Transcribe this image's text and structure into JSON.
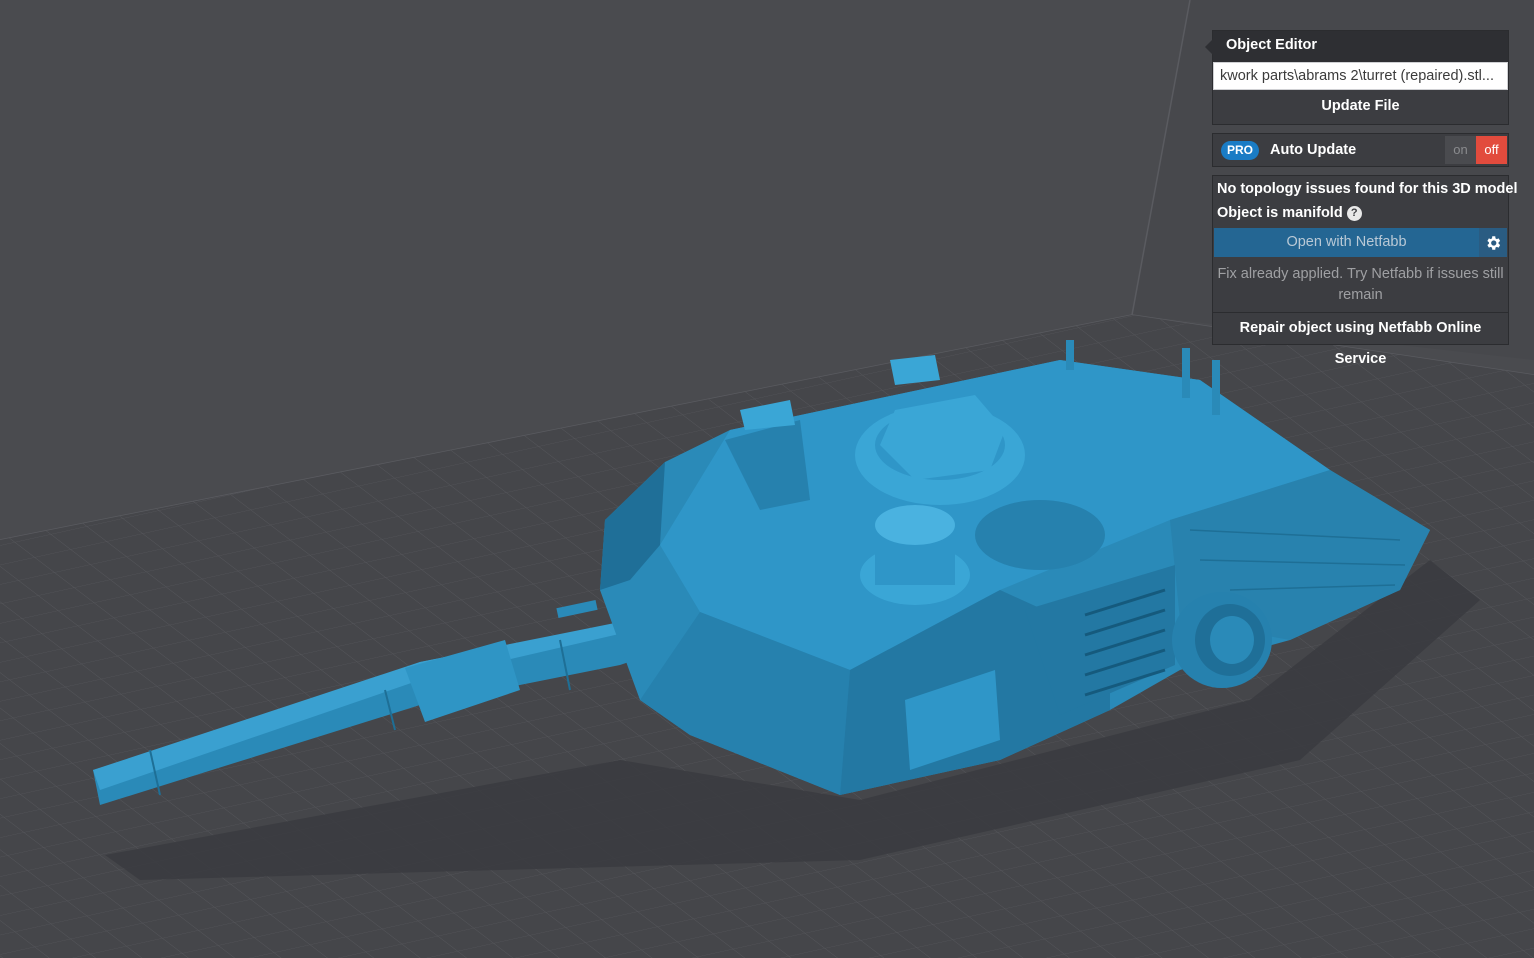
{
  "object_editor": {
    "title": "Object Editor",
    "file_path": "...kwork parts\\abrams 2\\turret (repaired).stl",
    "update_button": "Update File"
  },
  "auto_update": {
    "badge": "PRO",
    "label": "Auto Update",
    "on_label": "on",
    "off_label": "off",
    "state": "off"
  },
  "topology": {
    "status": "No topology issues found for this 3D model",
    "manifold": "Object is manifold",
    "help_icon": "?",
    "netfabb_button": "Open with Netfabb",
    "settings_icon": "gear-icon",
    "fix_note": "Fix already applied. Try Netfabb if issues still remain",
    "repair_button": "Repair object using Netfabb Online Service"
  },
  "colors": {
    "model": "#2a8ab8",
    "viewport_bg": "#4a4b4f",
    "toggle_off": "#e24b3d",
    "pro_badge": "#1a7cc5",
    "netfabb_button": "#246693"
  }
}
